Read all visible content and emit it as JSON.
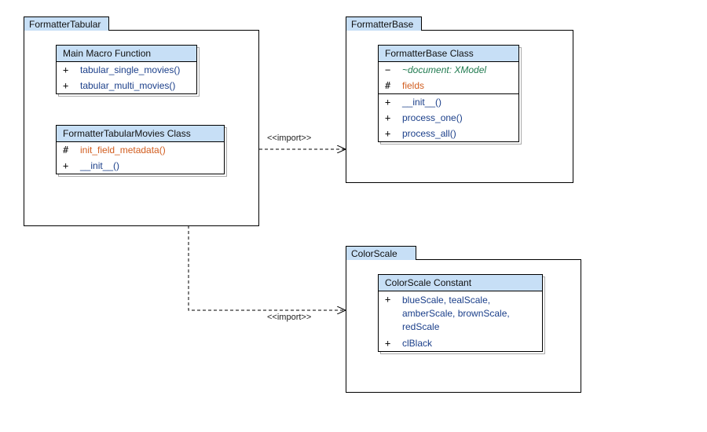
{
  "packages": {
    "p0": {
      "title": "FormatterTabular"
    },
    "p1": {
      "title": "FormatterBase"
    },
    "p2": {
      "title": "ColorScale"
    }
  },
  "classes": {
    "c0": {
      "title": "Main Macro Function",
      "members": [
        {
          "vis": "+",
          "name": "tabular_single_movies()",
          "kind": "pub"
        },
        {
          "vis": "+",
          "name": "tabular_multi_movies()",
          "kind": "pub"
        }
      ]
    },
    "c1": {
      "title": "FormatterTabularMovies Class",
      "members": [
        {
          "vis": "#",
          "name": "init_field_metadata()",
          "kind": "prot"
        },
        {
          "vis": "+",
          "name": "__init__()",
          "kind": "pub"
        }
      ]
    },
    "c2": {
      "title": "FormatterBase Class",
      "attrs": [
        {
          "vis": "−",
          "name": "~document: XModel",
          "kind": "priv"
        },
        {
          "vis": "#",
          "name": "fields",
          "kind": "prot"
        }
      ],
      "ops": [
        {
          "vis": "+",
          "name": "__init__()",
          "kind": "pub"
        },
        {
          "vis": "+",
          "name": "process_one()",
          "kind": "pub"
        },
        {
          "vis": "+",
          "name": "process_all()",
          "kind": "pub"
        }
      ]
    },
    "c3": {
      "title": "ColorScale Constant",
      "members": [
        {
          "vis": "+",
          "name": "blueScale, tealScale, amberScale, brownScale, redScale",
          "kind": "pub"
        },
        {
          "vis": "+",
          "name": "clBlack",
          "kind": "pub"
        }
      ]
    }
  },
  "relations": {
    "r0": {
      "label": "<<import>>"
    },
    "r1": {
      "label": "<<import>>"
    }
  }
}
